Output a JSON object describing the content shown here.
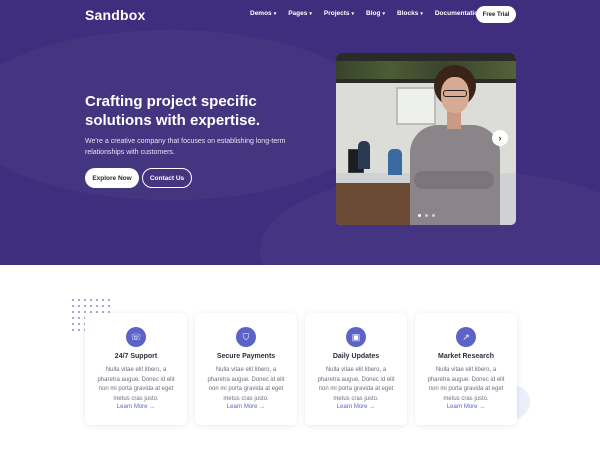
{
  "nav": {
    "logo": "Sandbox",
    "items": [
      {
        "label": "Demos"
      },
      {
        "label": "Pages"
      },
      {
        "label": "Projects"
      },
      {
        "label": "Blog"
      },
      {
        "label": "Blocks"
      },
      {
        "label": "Documentation"
      }
    ],
    "cta": "Free Trial"
  },
  "hero": {
    "title": "Crafting project specific solutions with expertise.",
    "subtitle": "We're a creative company that focuses on establishing long-term relationships with customers.",
    "primary_button": "Explore Now",
    "secondary_button": "Contact Us",
    "arrow_glyph": "›",
    "carousel_count": 3,
    "carousel_active": 0
  },
  "features": [
    {
      "icon": "headset-icon",
      "glyph": "☏",
      "title": "24/7 Support",
      "text": "Nulla vitae elit libero, a pharetra augue. Donec id elit non mi porta gravida at eget metus cras justo.",
      "link": "Learn More →"
    },
    {
      "icon": "shield-icon",
      "glyph": "⛉",
      "title": "Secure Payments",
      "text": "Nulla vitae elit libero, a pharetra augue. Donec id elit non mi porta gravida at eget metus cras justo.",
      "link": "Learn More →"
    },
    {
      "icon": "laptop-icon",
      "glyph": "▣",
      "title": "Daily Updates",
      "text": "Nulla vitae elit libero, a pharetra augue. Donec id elit non mi porta gravida at eget metus cras justo.",
      "link": "Learn More →"
    },
    {
      "icon": "chart-icon",
      "glyph": "↗",
      "title": "Market Research",
      "text": "Nulla vitae elit libero, a pharetra augue. Donec id elit non mi porta gravida at eget metus cras justo.",
      "link": "Learn More →"
    }
  ],
  "colors": {
    "hero_bg": "#3e2e7d",
    "accent": "#5b64c6"
  }
}
